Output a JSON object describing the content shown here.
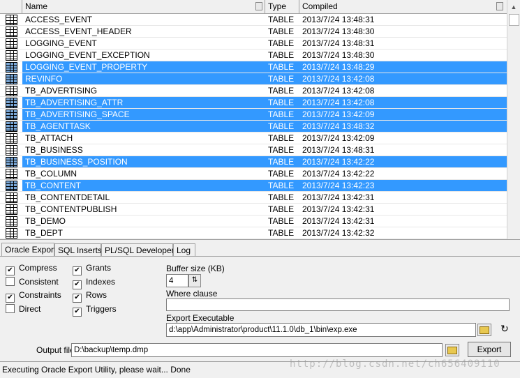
{
  "grid": {
    "columns": [
      "Name",
      "Type",
      "Compiled"
    ],
    "rows": [
      {
        "name": "ACCESS_EVENT",
        "type": "TABLE",
        "compiled": "2013/7/24 13:48:31",
        "selected": false
      },
      {
        "name": "ACCESS_EVENT_HEADER",
        "type": "TABLE",
        "compiled": "2013/7/24 13:48:30",
        "selected": false
      },
      {
        "name": "LOGGING_EVENT",
        "type": "TABLE",
        "compiled": "2013/7/24 13:48:31",
        "selected": false
      },
      {
        "name": "LOGGING_EVENT_EXCEPTION",
        "type": "TABLE",
        "compiled": "2013/7/24 13:48:30",
        "selected": false
      },
      {
        "name": "LOGGING_EVENT_PROPERTY",
        "type": "TABLE",
        "compiled": "2013/7/24 13:48:29",
        "selected": true
      },
      {
        "name": "REVINFO",
        "type": "TABLE",
        "compiled": "2013/7/24 13:42:08",
        "selected": true
      },
      {
        "name": "TB_ADVERTISING",
        "type": "TABLE",
        "compiled": "2013/7/24 13:42:08",
        "selected": false
      },
      {
        "name": "TB_ADVERTISING_ATTR",
        "type": "TABLE",
        "compiled": "2013/7/24 13:42:08",
        "selected": true
      },
      {
        "name": "TB_ADVERTISING_SPACE",
        "type": "TABLE",
        "compiled": "2013/7/24 13:42:09",
        "selected": true
      },
      {
        "name": "TB_AGENTTASK",
        "type": "TABLE",
        "compiled": "2013/7/24 13:48:32",
        "selected": true
      },
      {
        "name": "TB_ATTACH",
        "type": "TABLE",
        "compiled": "2013/7/24 13:42:09",
        "selected": false
      },
      {
        "name": "TB_BUSINESS",
        "type": "TABLE",
        "compiled": "2013/7/24 13:48:31",
        "selected": false
      },
      {
        "name": "TB_BUSINESS_POSITION",
        "type": "TABLE",
        "compiled": "2013/7/24 13:42:22",
        "selected": true
      },
      {
        "name": "TB_COLUMN",
        "type": "TABLE",
        "compiled": "2013/7/24 13:42:22",
        "selected": false
      },
      {
        "name": "TB_CONTENT",
        "type": "TABLE",
        "compiled": "2013/7/24 13:42:23",
        "selected": true
      },
      {
        "name": "TB_CONTENTDETAIL",
        "type": "TABLE",
        "compiled": "2013/7/24 13:42:31",
        "selected": false
      },
      {
        "name": "TB_CONTENTPUBLISH",
        "type": "TABLE",
        "compiled": "2013/7/24 13:42:31",
        "selected": false
      },
      {
        "name": "TB_DEMO",
        "type": "TABLE",
        "compiled": "2013/7/24 13:42:31",
        "selected": false
      },
      {
        "name": "TB_DEPT",
        "type": "TABLE",
        "compiled": "2013/7/24 13:42:32",
        "selected": false
      }
    ]
  },
  "tabs": [
    "Oracle Export",
    "SQL Inserts",
    "PL/SQL Developer",
    "Log"
  ],
  "options": [
    {
      "label": "Compress",
      "checked": true
    },
    {
      "label": "Consistent",
      "checked": false
    },
    {
      "label": "Constraints",
      "checked": true
    },
    {
      "label": "Direct",
      "checked": false
    },
    {
      "label": "Grants",
      "checked": true
    },
    {
      "label": "Indexes",
      "checked": true
    },
    {
      "label": "Rows",
      "checked": true
    },
    {
      "label": "Triggers",
      "checked": true
    }
  ],
  "buffer": {
    "label": "Buffer size (KB)",
    "value": "4"
  },
  "where": {
    "label": "Where clause",
    "value": ""
  },
  "executable": {
    "label": "Export Executable",
    "value": "d:\\app\\Administrator\\product\\11.1.0\\db_1\\bin\\exp.exe"
  },
  "output": {
    "label": "Output file",
    "value": "D:\\backup\\temp.dmp"
  },
  "export_button": "Export",
  "status": "Executing Oracle Export Utility, please wait...  Done",
  "watermark": "http://blog.csdn.net/ch656409110"
}
